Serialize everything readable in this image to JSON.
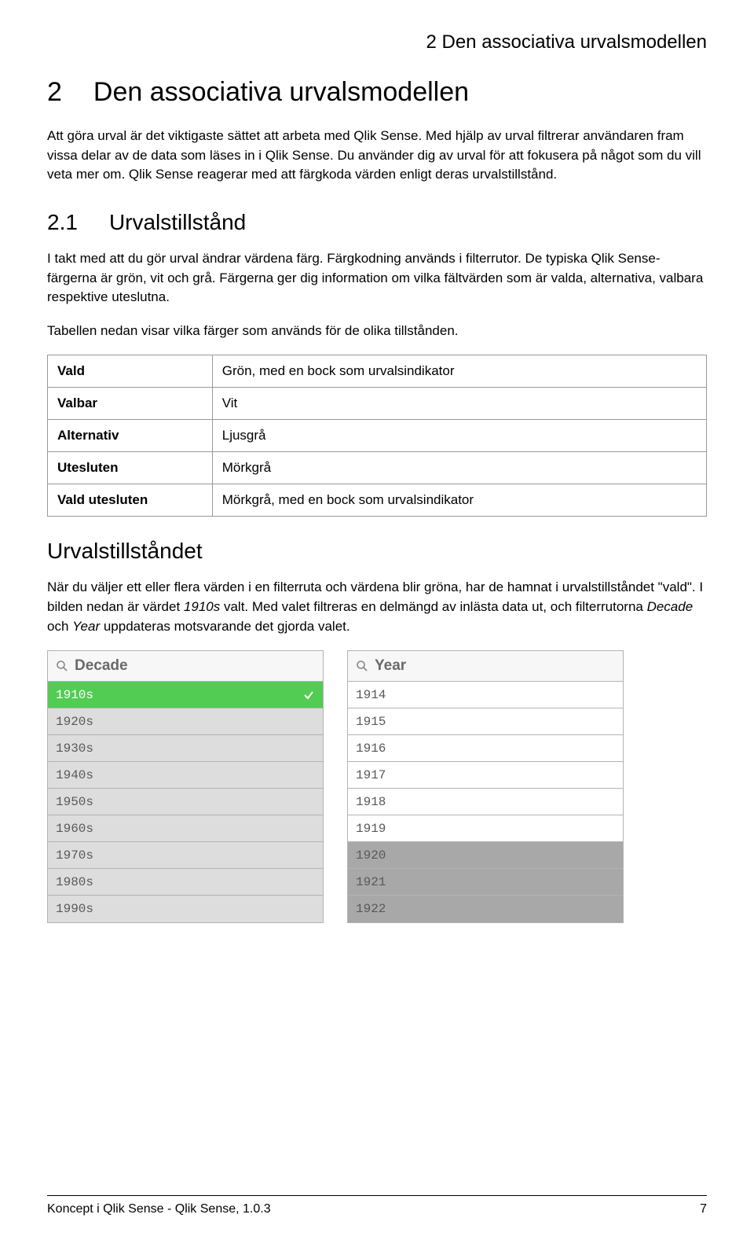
{
  "header": {
    "running_title": "2 Den associativa urvalsmodellen"
  },
  "chapter": {
    "number": "2",
    "title": "Den associativa urvalsmodellen",
    "intro": "Att göra urval är det viktigaste sättet att arbeta med Qlik Sense. Med hjälp av urval filtrerar användaren fram vissa delar av de data som läses in i Qlik Sense. Du använder dig av urval för att fokusera på något som du vill veta mer om. Qlik Sense reagerar med att färgkoda värden enligt deras urvalstillstånd."
  },
  "section": {
    "number": "2.1",
    "title": "Urvalstillstånd",
    "para1": "I takt med att du gör urval ändrar värdena färg. Färgkodning används i filterrutor. De typiska Qlik Sense-färgerna är grön, vit och grå. Färgerna ger dig information om vilka fältvärden som är valda, alternativa, valbara respektive uteslutna.",
    "para2": "Tabellen nedan visar vilka färger som används för de olika tillstånden."
  },
  "state_table": [
    {
      "label": "Vald",
      "desc": "Grön, med en bock som urvalsindikator"
    },
    {
      "label": "Valbar",
      "desc": "Vit"
    },
    {
      "label": "Alternativ",
      "desc": "Ljusgrå"
    },
    {
      "label": "Utesluten",
      "desc": "Mörkgrå"
    },
    {
      "label": "Vald utesluten",
      "desc": "Mörkgrå, med en bock som urvalsindikator"
    }
  ],
  "subsection": {
    "title": "Urvalstillståndet",
    "para_prefix": "När du väljer ett eller flera värden i en filterruta och värdena blir gröna, har de hamnat i urvalstillståndet \"vald\". I bilden nedan är värdet ",
    "para_italic1": "1910s",
    "para_mid": " valt. Med valet filtreras en delmängd av inlästa data ut, och filterrutorna ",
    "para_italic2": "Decade",
    "para_and": " och ",
    "para_italic3": "Year",
    "para_suffix": " uppdateras motsvarande det gjorda valet."
  },
  "filter_boxes": {
    "decade": {
      "title": "Decade",
      "rows": [
        {
          "label": "1910s",
          "state": "selected",
          "check": true
        },
        {
          "label": "1920s",
          "state": "light"
        },
        {
          "label": "1930s",
          "state": "light"
        },
        {
          "label": "1940s",
          "state": "light"
        },
        {
          "label": "1950s",
          "state": "light"
        },
        {
          "label": "1960s",
          "state": "light"
        },
        {
          "label": "1970s",
          "state": "light"
        },
        {
          "label": "1980s",
          "state": "light"
        },
        {
          "label": "1990s",
          "state": "light"
        }
      ]
    },
    "year": {
      "title": "Year",
      "rows": [
        {
          "label": "1914",
          "state": "white"
        },
        {
          "label": "1915",
          "state": "white"
        },
        {
          "label": "1916",
          "state": "white"
        },
        {
          "label": "1917",
          "state": "white"
        },
        {
          "label": "1918",
          "state": "white"
        },
        {
          "label": "1919",
          "state": "white"
        },
        {
          "label": "1920",
          "state": "dark"
        },
        {
          "label": "1921",
          "state": "dark"
        },
        {
          "label": "1922",
          "state": "dark"
        }
      ]
    }
  },
  "footer": {
    "left": "Koncept i Qlik Sense - Qlik Sense, 1.0.3",
    "right": "7"
  }
}
